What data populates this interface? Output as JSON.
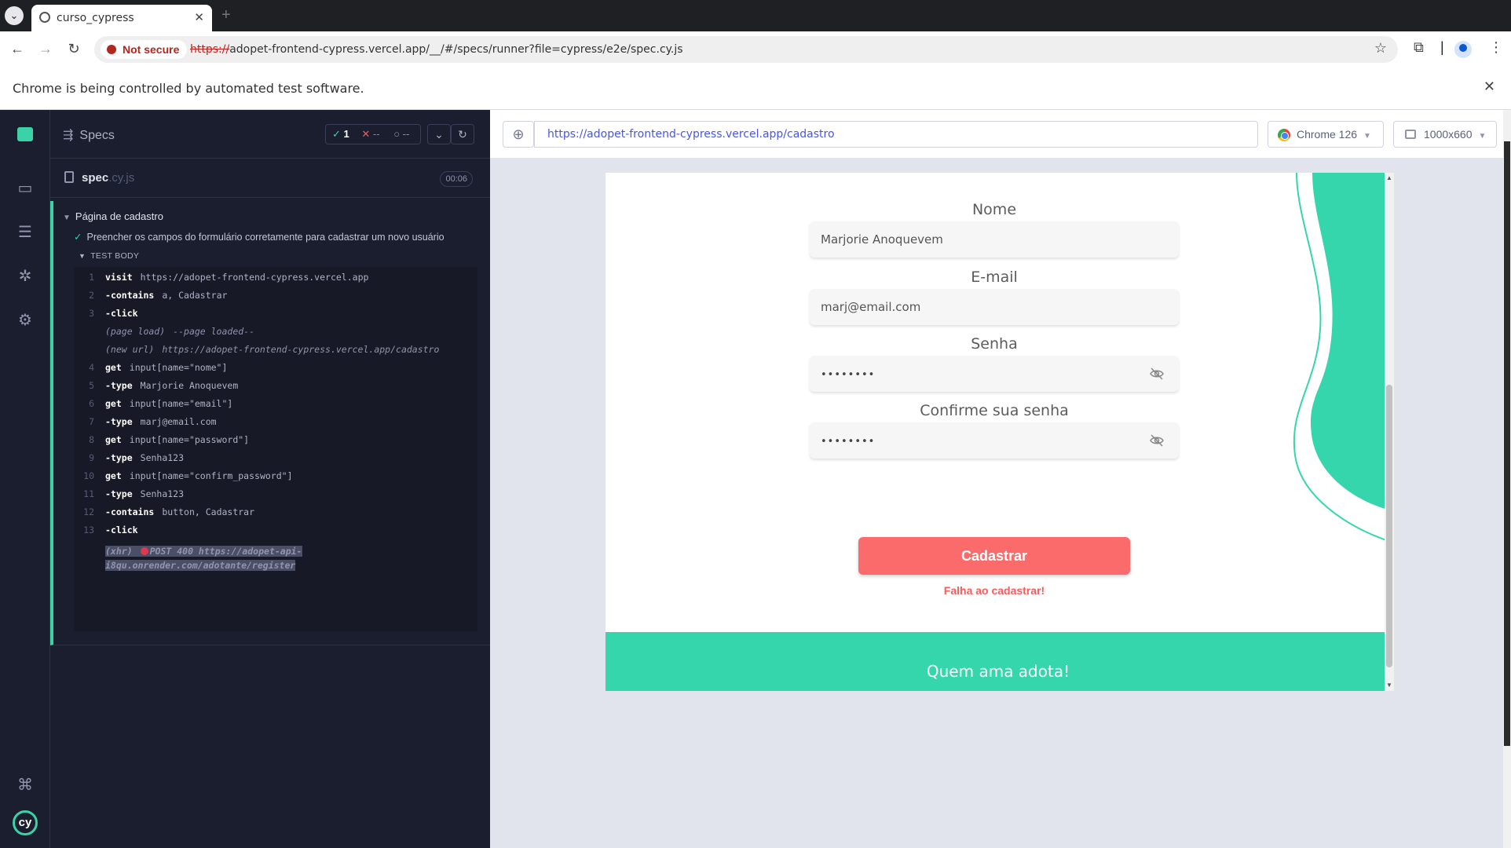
{
  "browser": {
    "tab_title": "curso_cypress",
    "not_secure_label": "Not secure",
    "url_scheme": "https://",
    "url_rest": "adopet-frontend-cypress.vercel.app/__/#/specs/runner?file=cypress/e2e/spec.cy.js",
    "infobar_text": "Chrome is being controlled by automated test software."
  },
  "reporter": {
    "specs_label": "Specs",
    "passed_count": "1",
    "failed_count": "--",
    "pending_count": "--",
    "spec_name": "spec",
    "spec_ext": ".cy.js",
    "duration": "00:06",
    "suite_title": "Página de cadastro",
    "test_title": "Preencher os campos do formulário corretamente para cadastrar um novo usuário",
    "test_body_label": "TEST BODY",
    "commands": [
      {
        "num": "1",
        "name": "visit",
        "child": false,
        "msg": "https://adopet-frontend-cypress.vercel.app"
      },
      {
        "num": "2",
        "name": "contains",
        "child": true,
        "msg": "a, Cadastrar"
      },
      {
        "num": "3",
        "name": "click",
        "child": true,
        "msg": ""
      },
      {
        "num": "",
        "event": "(page load)",
        "msg": "--page loaded--"
      },
      {
        "num": "",
        "event": "(new url)",
        "msg": "https://adopet-frontend-cypress.vercel.app/cadastro"
      },
      {
        "num": "4",
        "name": "get",
        "child": false,
        "msg": "input[name=\"nome\"]"
      },
      {
        "num": "5",
        "name": "type",
        "child": true,
        "msg": "Marjorie Anoquevem"
      },
      {
        "num": "6",
        "name": "get",
        "child": false,
        "msg": "input[name=\"email\"]"
      },
      {
        "num": "7",
        "name": "type",
        "child": true,
        "msg": "marj@email.com"
      },
      {
        "num": "8",
        "name": "get",
        "child": false,
        "msg": "input[name=\"password\"]"
      },
      {
        "num": "9",
        "name": "type",
        "child": true,
        "msg": "Senha123"
      },
      {
        "num": "10",
        "name": "get",
        "child": false,
        "msg": "input[name=\"confirm_password\"]"
      },
      {
        "num": "11",
        "name": "type",
        "child": true,
        "msg": "Senha123"
      },
      {
        "num": "12",
        "name": "contains",
        "child": true,
        "msg": "button, Cadastrar"
      },
      {
        "num": "13",
        "name": "click",
        "child": true,
        "msg": ""
      }
    ],
    "xhr": {
      "event": "(xhr)",
      "line1": "POST 400 https://adopet-api-",
      "line2": "i8qu.onrender.com/adotante/register"
    }
  },
  "aut": {
    "url": "https://adopet-frontend-cypress.vercel.app/cadastro",
    "browser_label": "Chrome 126",
    "viewport_label": "1000x660"
  },
  "app": {
    "nome_label": "Nome",
    "nome_value": "Marjorie Anoquevem",
    "email_label": "E-mail",
    "email_value": "marj@email.com",
    "senha_label": "Senha",
    "senha_value": "••••••••",
    "confirm_label": "Confirme sua senha",
    "confirm_value": "••••••••",
    "submit_label": "Cadastrar",
    "error_message": "Falha ao cadastrar!",
    "footer_text": "Quem ama adota!",
    "accent_color": "#36d6ad",
    "button_color": "#fc6b6b"
  }
}
